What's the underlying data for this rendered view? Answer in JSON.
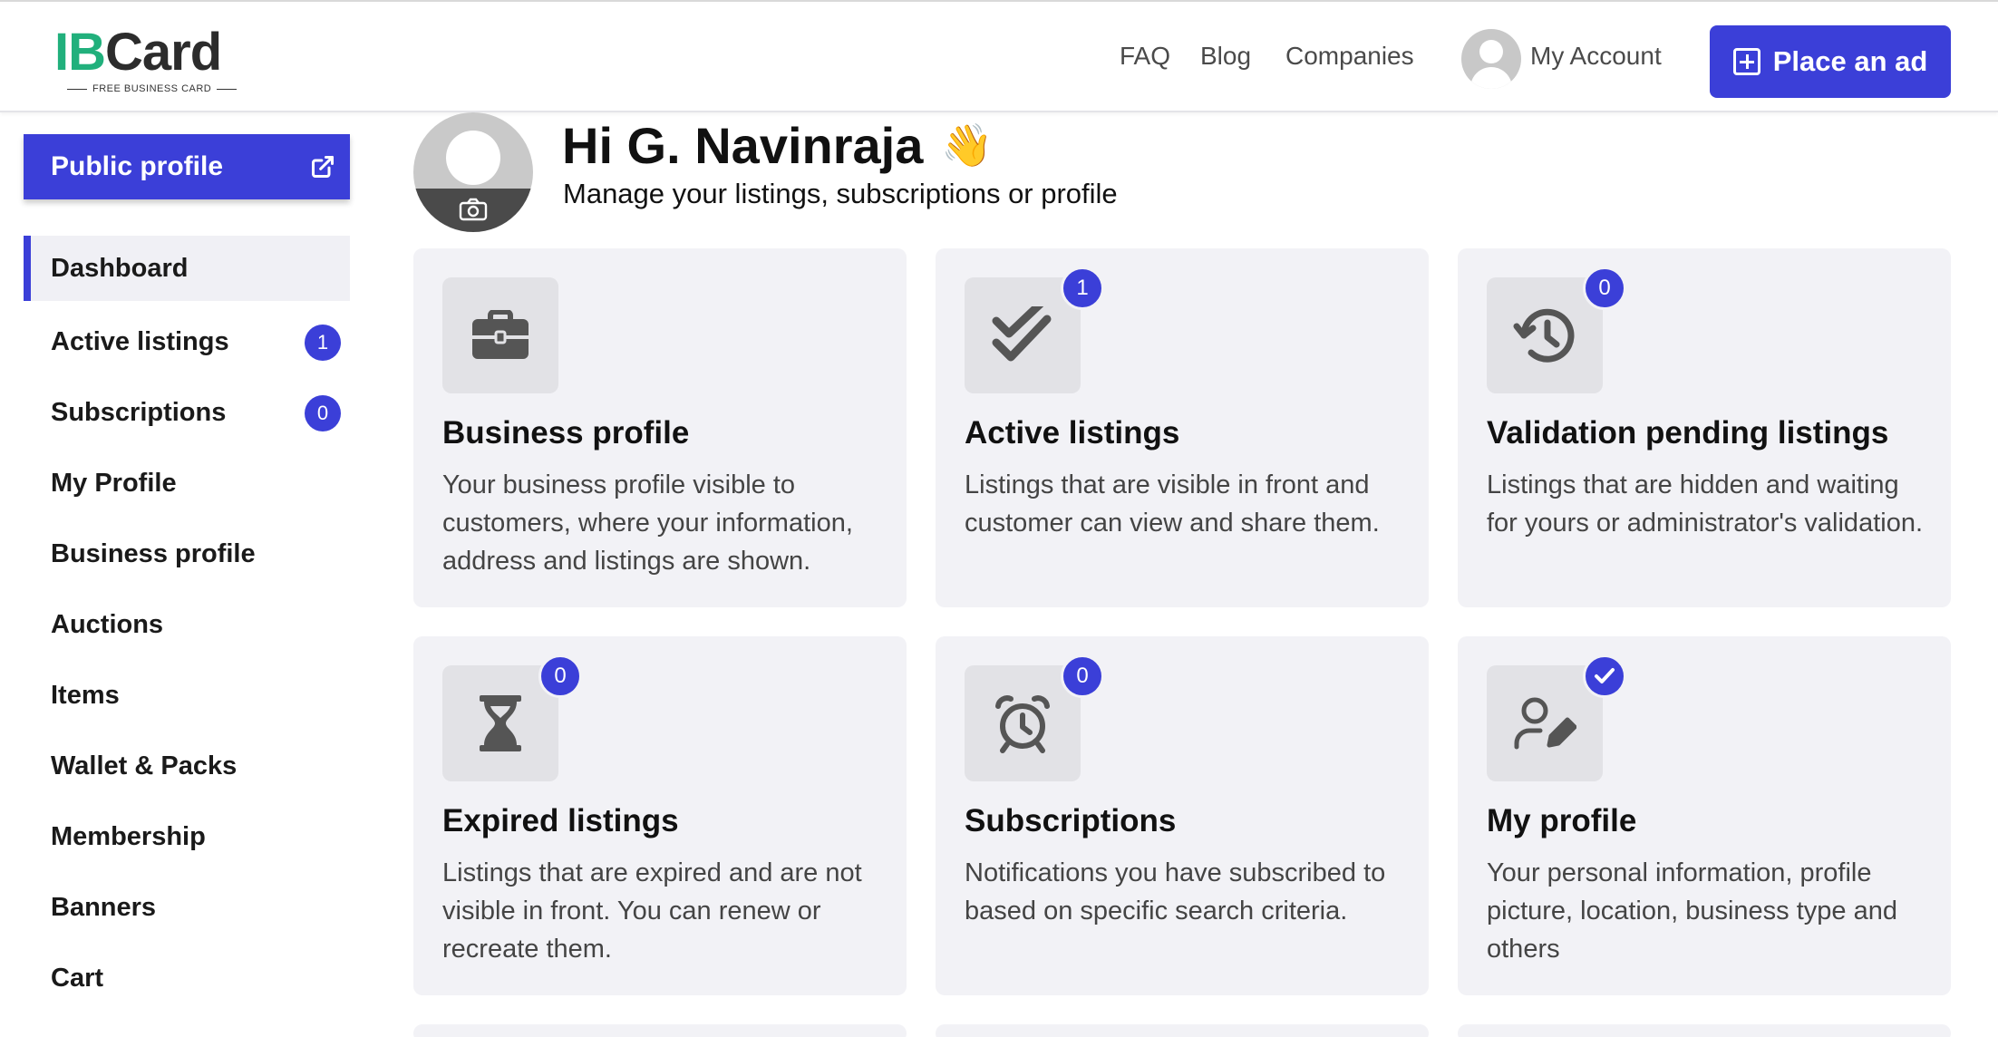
{
  "header": {
    "logo": {
      "ib": "IB",
      "rest": "Card",
      "tagline": "FREE BUSINESS CARD"
    },
    "nav": [
      {
        "label": "FAQ"
      },
      {
        "label": "Blog"
      },
      {
        "label": "Companies"
      }
    ],
    "account_label": "My Account",
    "place_ad_label": "Place an ad"
  },
  "sidebar": {
    "public_profile_label": "Public profile",
    "items": [
      {
        "label": "Dashboard",
        "active": true
      },
      {
        "label": "Active listings",
        "badge": "1"
      },
      {
        "label": "Subscriptions",
        "badge": "0"
      },
      {
        "label": "My Profile"
      },
      {
        "label": "Business profile"
      },
      {
        "label": "Auctions"
      },
      {
        "label": "Items"
      },
      {
        "label": "Wallet & Packs"
      },
      {
        "label": "Membership"
      },
      {
        "label": "Banners"
      },
      {
        "label": "Cart"
      }
    ]
  },
  "greeting": {
    "title": "Hi G. Navinraja",
    "subtitle": "Manage your listings, subscriptions or profile"
  },
  "cards": [
    {
      "title": "Business profile",
      "desc": "Your business profile visible to customers, where your information, address and listings are shown.",
      "icon": "briefcase-icon"
    },
    {
      "title": "Active listings",
      "desc": "Listings that are visible in front and customer can view and share them.",
      "badge": "1",
      "icon": "double-check-icon"
    },
    {
      "title": "Validation pending listings",
      "desc": "Listings that are hidden and waiting for yours or administrator's validation.",
      "badge": "0",
      "icon": "history-icon"
    },
    {
      "title": "Expired listings",
      "desc": "Listings that are expired and are not visible in front. You can renew or recreate them.",
      "badge": "0",
      "icon": "hourglass-icon"
    },
    {
      "title": "Subscriptions",
      "desc": "Notifications you have subscribed to based on specific search criteria.",
      "badge": "0",
      "icon": "alarm-clock-icon"
    },
    {
      "title": "My profile",
      "desc": "Your personal information, profile picture, location, business type and others",
      "icon": "user-edit-icon"
    }
  ],
  "colors": {
    "accent": "#3b3fd8",
    "card_bg": "#f2f2f6",
    "icon_bg": "#e2e2e6",
    "logo_green": "#21b07c"
  }
}
